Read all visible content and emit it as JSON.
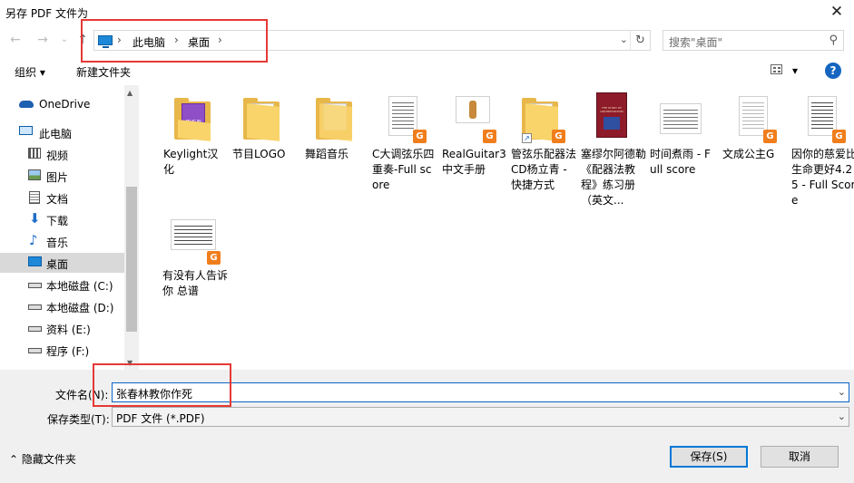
{
  "window": {
    "title": "另存 PDF 文件为",
    "close_glyph": "✕"
  },
  "nav": {
    "back_glyph": "←",
    "forward_glyph": "→",
    "recent_glyph": "⌄",
    "up_glyph": "↑",
    "breadcrumb": [
      "此电脑",
      "桌面"
    ],
    "separator": "›",
    "dropdown_glyph": "⌄",
    "refresh_glyph": "↻"
  },
  "search": {
    "placeholder": "搜索\"桌面\"",
    "icon_glyph": "⚲"
  },
  "toolbar": {
    "organize_label": "组织 ▾",
    "new_folder_label": "新建文件夹",
    "view_dropdown": "▾",
    "help_glyph": "?"
  },
  "sidebar": {
    "items": [
      {
        "label": "OneDrive",
        "icon": "cloud-icon"
      },
      {
        "label": "此电脑",
        "icon": "computer-icon"
      },
      {
        "label": "视频",
        "icon": "video-icon"
      },
      {
        "label": "图片",
        "icon": "picture-icon"
      },
      {
        "label": "文档",
        "icon": "document-icon"
      },
      {
        "label": "下载",
        "icon": "download-icon"
      },
      {
        "label": "音乐",
        "icon": "music-icon"
      },
      {
        "label": "桌面",
        "icon": "desktop-icon",
        "selected": true
      },
      {
        "label": "本地磁盘 (C:)",
        "icon": "drive-icon"
      },
      {
        "label": "本地磁盘 (D:)",
        "icon": "drive-icon"
      },
      {
        "label": "资料 (E:)",
        "icon": "drive-icon"
      },
      {
        "label": "程序 (F:)",
        "icon": "drive-icon"
      }
    ],
    "scroll_up": "▲",
    "scroll_down": "▼"
  },
  "files": [
    {
      "name": "Keylight汉化",
      "kind": "folder-plugin"
    },
    {
      "name": "节目LOGO",
      "kind": "folder"
    },
    {
      "name": "舞蹈音乐",
      "kind": "folder"
    },
    {
      "name": "C大调弦乐四重奏-Full score",
      "kind": "pdf"
    },
    {
      "name": "RealGuitar3中文手册",
      "kind": "pdf"
    },
    {
      "name": "管弦乐配器法CD杨立青 - 快捷方式",
      "kind": "shortcut-folder"
    },
    {
      "name": "塞缪尔阿德勒《配器法教程》练习册（英文...",
      "kind": "book"
    },
    {
      "name": "时间煮雨 - Full score",
      "kind": "pdf"
    },
    {
      "name": "文成公主G",
      "kind": "pdf"
    },
    {
      "name": "因你的慈爱比生命更好4.25 - Full Score",
      "kind": "pdf"
    },
    {
      "name": "有没有人告诉你 总谱",
      "kind": "pdf"
    }
  ],
  "badge_glyph": "G",
  "shortcut_glyph": "↗",
  "plugin_label": "PLUG-IN",
  "book_title": "THE STUDY OF ORCHESTRATION",
  "bottom": {
    "filename_label": "文件名(N):",
    "filename_value": "张春林教你作死",
    "type_label": "保存类型(T):",
    "type_value": "PDF 文件 (*.PDF)",
    "arrow": "⌄",
    "hide_folders": "⌃  隐藏文件夹",
    "save_label": "保存(S)",
    "cancel_label": "取消"
  },
  "colors": {
    "accent": "#0078d7",
    "highlight_box": "#e53935",
    "folder": "#f9d46b",
    "badge": "#f07e1d"
  }
}
